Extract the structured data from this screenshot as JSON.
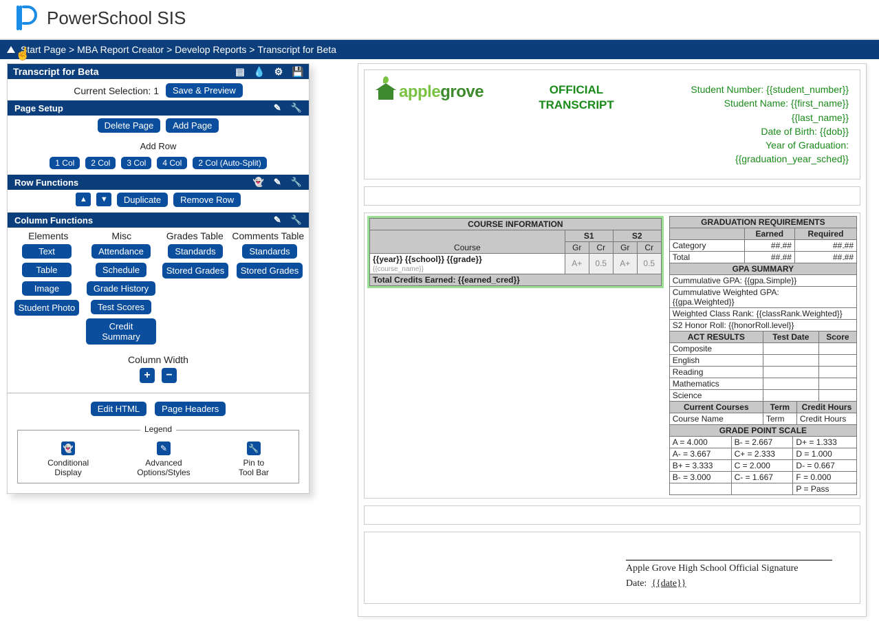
{
  "header": {
    "app_title": "PowerSchool SIS"
  },
  "breadcrumb": {
    "items": [
      "Start Page",
      "MBA Report Creator",
      "Develop Reports",
      "Transcript for Beta"
    ]
  },
  "panel": {
    "title": "Transcript for Beta",
    "selection_label": "Current Selection: 1",
    "save_preview": "Save & Preview",
    "page_setup": "Page Setup",
    "delete_page": "Delete Page",
    "add_page": "Add Page",
    "add_row_label": "Add Row",
    "col_buttons": [
      "1 Col",
      "2 Col",
      "3 Col",
      "4 Col",
      "2 Col (Auto-Split)"
    ],
    "row_functions": "Row Functions",
    "duplicate": "Duplicate",
    "remove_row": "Remove Row",
    "column_functions": "Column Functions",
    "col_headers": [
      "Elements",
      "Misc",
      "Grades Table",
      "Comments Table"
    ],
    "elements": [
      "Text",
      "Table",
      "Image",
      "Student Photo"
    ],
    "misc": [
      "Attendance",
      "Schedule",
      "Grade History",
      "Test Scores",
      "Credit Summary"
    ],
    "grades_table": [
      "Standards",
      "Stored Grades"
    ],
    "comments_table": [
      "Standards",
      "Stored Grades"
    ],
    "column_width_label": "Column Width",
    "edit_html": "Edit HTML",
    "page_headers": "Page Headers",
    "legend_title": "Legend",
    "legend": {
      "cond1": "Conditional",
      "cond2": "Display",
      "adv1": "Advanced",
      "adv2": "Options/Styles",
      "pin1": "Pin to",
      "pin2": "Tool Bar"
    }
  },
  "preview": {
    "logo_part1": "apple",
    "logo_part2": "grove",
    "official1": "OFFICIAL",
    "official2": "TRANSCRIPT",
    "meta": {
      "l1": "Student Number: {{student_number}}",
      "l2": "Student Name: {{first_name}}",
      "l3": "{{last_name}}",
      "l4": "Date of Birth: {{dob}}",
      "l5": "Year of Graduation:",
      "l6": "{{graduation_year_sched}}"
    },
    "course_info": {
      "title": "COURSE INFORMATION",
      "course": "Course",
      "s1": "S1",
      "s2": "S2",
      "gr": "Gr",
      "cr": "Cr",
      "row1": "{{year}} {{school}} {{grade}}",
      "row2": "{{course_name}}",
      "gr_val": "A+",
      "cr_val": "0.5",
      "total": "Total Credits Earned: {{earned_cred}}"
    },
    "grad_req": {
      "title": "GRADUATION REQUIREMENTS",
      "earned": "Earned",
      "required": "Required",
      "category": "Category",
      "total": "Total",
      "placeholder": "##.##"
    },
    "gpa": {
      "title": "GPA SUMMARY",
      "l1": "Cummulative GPA: {{gpa.Simple}}",
      "l2a": "Cummulative Weighted GPA:",
      "l2b": "{{gpa.Weighted}}",
      "l3": "Weighted Class Rank: {{classRank.Weighted}}",
      "l4": "S2 Honor Roll: {{honorRoll.level}}"
    },
    "act": {
      "title": "ACT RESULTS",
      "date": "Test Date",
      "score": "Score",
      "rows": [
        "Composite",
        "English",
        "Reading",
        "Mathematics",
        "Science"
      ]
    },
    "current": {
      "title": "Current Courses",
      "term": "Term",
      "credit": "Credit Hours",
      "course_name": "Course Name"
    },
    "scale": {
      "title": "GRADE POINT SCALE",
      "rows": [
        [
          "A = 4.000",
          "B- = 2.667",
          "D+ = 1.333"
        ],
        [
          "A- = 3.667",
          "C+ = 2.333",
          "D = 1.000"
        ],
        [
          "B+ = 3.333",
          "C = 2.000",
          "D- = 0.667"
        ],
        [
          "B- = 3.000",
          "C- = 1.667",
          "F = 0.000"
        ],
        [
          "",
          "",
          "P = Pass"
        ]
      ]
    },
    "signature": {
      "school": "Apple Grove High School Official Signature",
      "date_label": "Date:",
      "date_value": "{{date}}"
    }
  }
}
